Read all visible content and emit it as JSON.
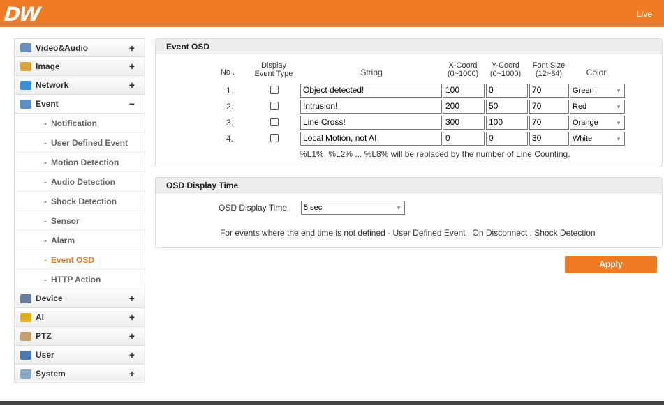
{
  "header": {
    "logo": "DW",
    "live_link": "Live"
  },
  "sidebar": {
    "items": [
      {
        "label": "Video&Audio",
        "toggle": "+",
        "icon": "video-audio-icon",
        "color": "#6b8fbf"
      },
      {
        "label": "Image",
        "toggle": "+",
        "icon": "image-icon",
        "color": "#d9a23b"
      },
      {
        "label": "Network",
        "toggle": "+",
        "icon": "network-icon",
        "color": "#3b8fd9"
      },
      {
        "label": "Event",
        "toggle": "−",
        "icon": "event-icon",
        "color": "#5b8fc9"
      }
    ],
    "event_subitems": [
      "Notification",
      "User Defined Event",
      "Motion Detection",
      "Audio Detection",
      "Shock Detection",
      "Sensor",
      "Alarm",
      "Event OSD",
      "HTTP Action"
    ],
    "bullet": "-",
    "items_after": [
      {
        "label": "Device",
        "toggle": "+",
        "icon": "device-icon",
        "color": "#6a7ea0"
      },
      {
        "label": "AI",
        "toggle": "+",
        "icon": "ai-icon",
        "color": "#e0b020"
      },
      {
        "label": "PTZ",
        "toggle": "+",
        "icon": "ptz-icon",
        "color": "#c9a06b"
      },
      {
        "label": "User",
        "toggle": "+",
        "icon": "user-icon",
        "color": "#4a7ab5"
      },
      {
        "label": "System",
        "toggle": "+",
        "icon": "system-icon",
        "color": "#8aa7c9"
      }
    ]
  },
  "event_osd": {
    "title": "Event OSD",
    "headers": {
      "no": "No .",
      "display_1": "Display",
      "display_2": "Event Type",
      "string": "String",
      "x_1": "X-Coord",
      "x_2": "(0~1000)",
      "y_1": "Y-Coord",
      "y_2": "(0~1000)",
      "font_1": "Font Size",
      "font_2": "(12~84)",
      "color": "Color"
    },
    "rows": [
      {
        "no": "1.",
        "string": "Object detected!",
        "x": "100",
        "y": "0",
        "font": "70",
        "color": "Green"
      },
      {
        "no": "2.",
        "string": "Intrusion!",
        "x": "200",
        "y": "50",
        "font": "70",
        "color": "Red"
      },
      {
        "no": "3.",
        "string": "Line Cross!",
        "x": "300",
        "y": "100",
        "font": "70",
        "color": "Orange"
      },
      {
        "no": "4.",
        "string": "Local Motion, not AI",
        "x": "0",
        "y": "0",
        "font": "30",
        "color": "White"
      }
    ],
    "note": "%L1%, %L2% ... %L8% will be replaced by the number of Line Counting."
  },
  "osd_display_time": {
    "title": "OSD Display Time",
    "label": "OSD Display Time",
    "value": "5 sec",
    "note": "For events where the end time is not defined - User Defined Event , On Disconnect , Shock Detection"
  },
  "apply_label": "Apply",
  "accent_color": "#f07b22"
}
